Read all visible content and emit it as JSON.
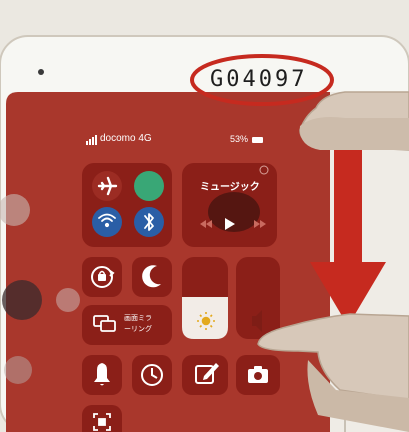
{
  "device": {
    "serial_label": "G04097"
  },
  "status_bar": {
    "carrier": "docomo 4G",
    "battery": "53%"
  },
  "music_tile": {
    "label": "ミュージック"
  },
  "screen_mirroring_tile": {
    "label_line1": "画面ミラ",
    "label_line2": "ーリング"
  },
  "colors": {
    "screen_red": "#a9372c",
    "tile_red": "#8b1f18",
    "annotation_red": "#c62a1f",
    "wifi_blue": "#2a5ea6",
    "cellular_green": "#39a776"
  },
  "icons": [
    "airplane-icon",
    "wifi-icon",
    "bluetooth-icon",
    "rotation-lock-icon",
    "moon-icon",
    "screen-mirroring-icon",
    "brightness-icon",
    "bell-icon",
    "timer-icon",
    "notes-icon",
    "camera-icon",
    "qr-scanner-icon",
    "play-icon"
  ]
}
